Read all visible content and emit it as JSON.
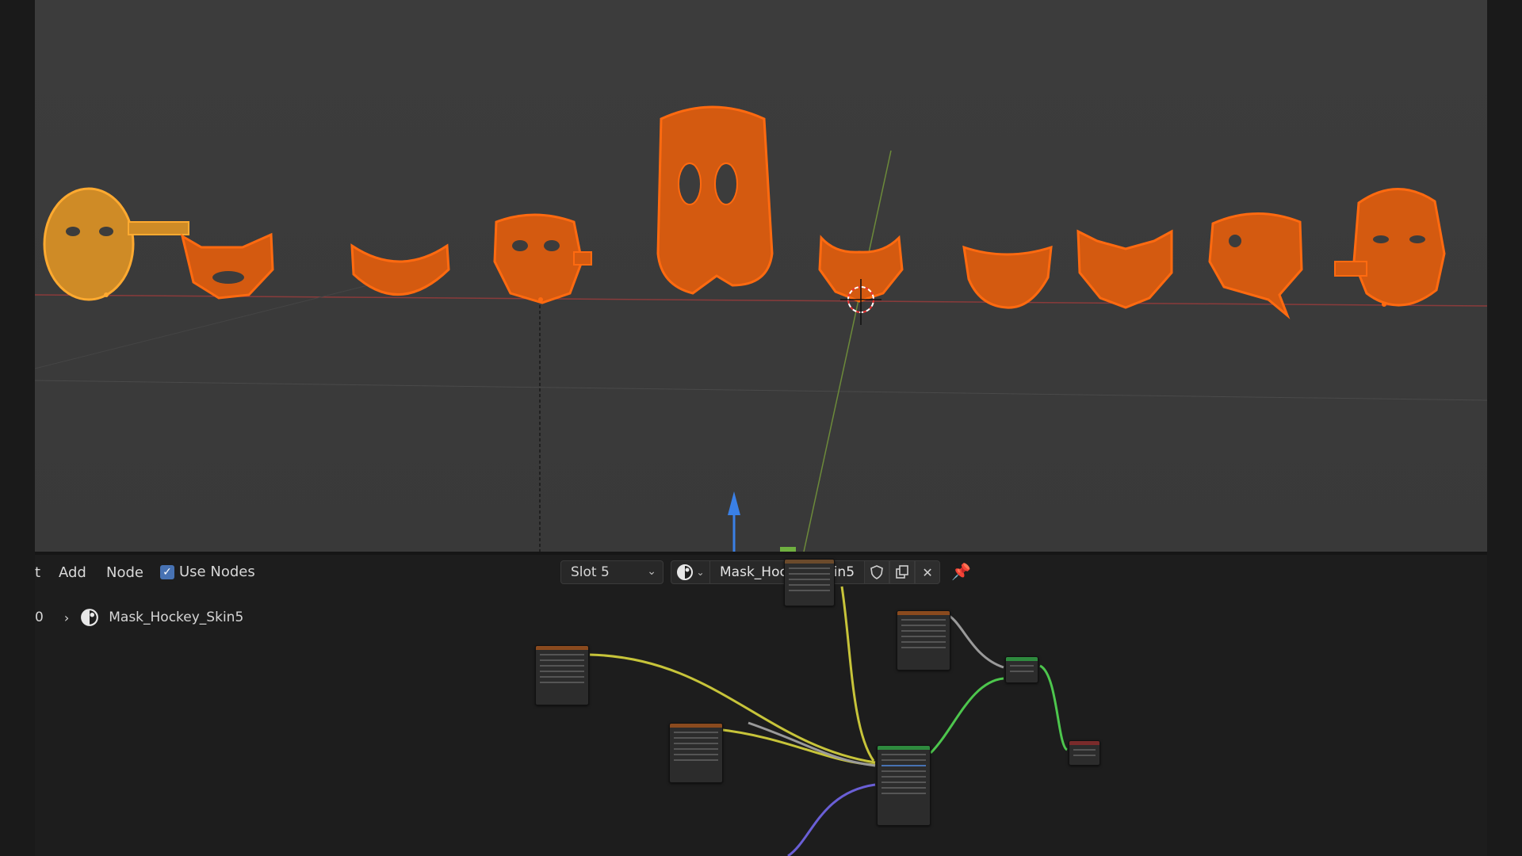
{
  "node_editor": {
    "header": {
      "menu_truncated": "t",
      "menu_add": "Add",
      "menu_node": "Node",
      "use_nodes_label": "Use Nodes",
      "use_nodes_checked": true,
      "slot_label": "Slot 5",
      "material_name": "Mask_Hockey_Skin5"
    },
    "breadcrumb": {
      "index": "0",
      "material_name": "Mask_Hockey_Skin5"
    }
  },
  "colors": {
    "wireframe_selected": "#ff6a10",
    "wireframe_active": "#ffaa30",
    "viewport_bg": "#3c3c3c",
    "node_editor_bg": "#1d1d1d",
    "accent_blue": "#4772b3"
  }
}
